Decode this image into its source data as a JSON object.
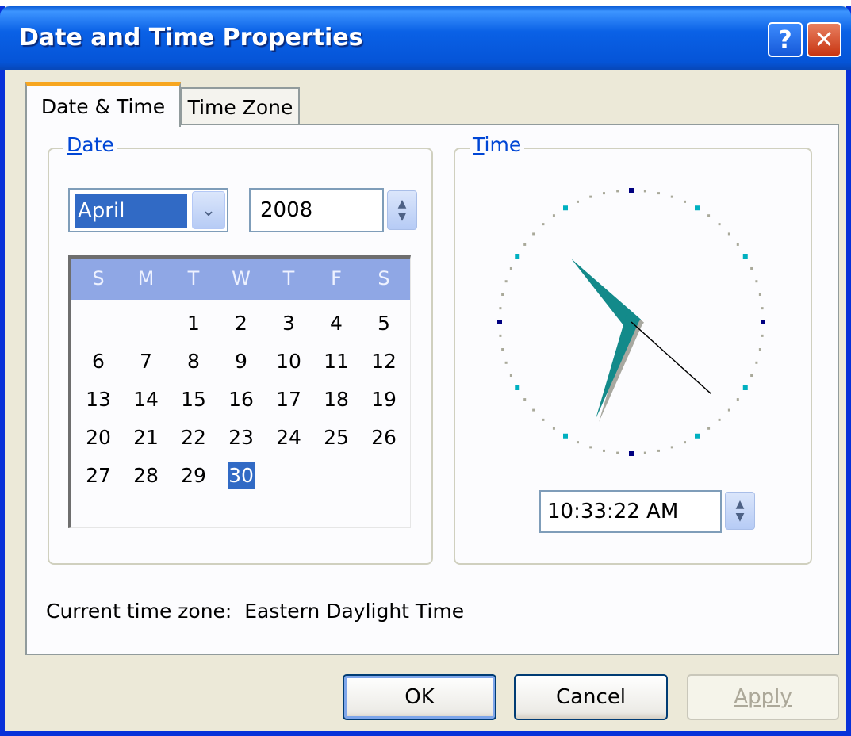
{
  "window": {
    "title": "Date and Time Properties",
    "help_glyph": "?",
    "close_glyph": "✕"
  },
  "tabs": [
    {
      "label": "Date & Time",
      "active": true
    },
    {
      "label": "Time Zone",
      "active": false
    }
  ],
  "date_group": {
    "legend_accel": "D",
    "legend_rest": "ate",
    "month": "April",
    "year": "2008",
    "weekdays": [
      "S",
      "M",
      "T",
      "W",
      "T",
      "F",
      "S"
    ],
    "days": [
      1,
      2,
      3,
      4,
      5,
      6,
      7,
      8,
      9,
      10,
      11,
      12,
      13,
      14,
      15,
      16,
      17,
      18,
      19,
      20,
      21,
      22,
      23,
      24,
      25,
      26,
      27,
      28,
      29,
      30
    ],
    "first_weekday_index": 2,
    "selected_day": 30
  },
  "time_group": {
    "legend_accel": "T",
    "legend_rest": "ime",
    "time_value": "10:33:22 AM",
    "clock": {
      "hour": 10,
      "minute": 33,
      "second": 22
    }
  },
  "timezone": {
    "label": "Current time zone:",
    "value": "Eastern Daylight Time"
  },
  "buttons": {
    "ok": "OK",
    "cancel": "Cancel",
    "apply": "Apply"
  },
  "colors": {
    "title_bar": "#0a61e6",
    "selection": "#316ac5",
    "clock_hand": "#138a8a",
    "tab_highlight": "#f7a620"
  },
  "icons": {
    "dropdown": "chevron-down-icon",
    "spin": "spin-updown-icon",
    "help": "help-icon",
    "close": "close-icon"
  }
}
